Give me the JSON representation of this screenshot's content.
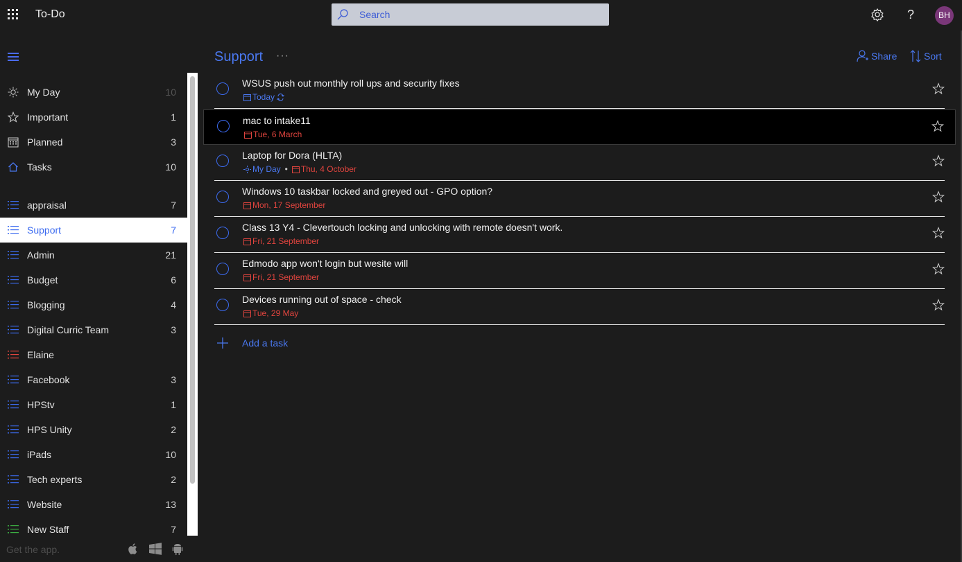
{
  "app": {
    "title": "To-Do"
  },
  "search": {
    "placeholder": "Search"
  },
  "user": {
    "initials": "BH"
  },
  "header_icons": [
    "waffle-icon",
    "gear-icon",
    "help-icon"
  ],
  "sidebar": {
    "smart_lists": [
      {
        "label": "My Day",
        "count": "10",
        "icon": "sun-icon"
      },
      {
        "label": "Important",
        "count": "1",
        "icon": "star-icon"
      },
      {
        "label": "Planned",
        "count": "3",
        "icon": "calendar-icon"
      },
      {
        "label": "Tasks",
        "count": "10",
        "icon": "home-icon"
      }
    ],
    "lists": [
      {
        "label": "appraisal",
        "count": "7",
        "color": "#3c6bf0"
      },
      {
        "label": "Support",
        "count": "7",
        "color": "#3c6bf0",
        "active": true
      },
      {
        "label": "Admin",
        "count": "21",
        "color": "#3c6bf0"
      },
      {
        "label": "Budget",
        "count": "6",
        "color": "#3c6bf0"
      },
      {
        "label": "Blogging",
        "count": "4",
        "color": "#3c6bf0"
      },
      {
        "label": "Digital Curric Team",
        "count": "3",
        "color": "#3c6bf0"
      },
      {
        "label": "Elaine",
        "count": "",
        "color": "#e0443e"
      },
      {
        "label": "Facebook",
        "count": "3",
        "color": "#3c6bf0"
      },
      {
        "label": "HPStv",
        "count": "1",
        "color": "#3c6bf0"
      },
      {
        "label": "HPS Unity",
        "count": "2",
        "color": "#3c6bf0"
      },
      {
        "label": "iPads",
        "count": "10",
        "color": "#3c6bf0"
      },
      {
        "label": "Tech experts",
        "count": "2",
        "color": "#3c6bf0"
      },
      {
        "label": "Website",
        "count": "13",
        "color": "#3c6bf0"
      },
      {
        "label": "New Staff",
        "count": "7",
        "color": "#3cb043"
      }
    ],
    "get_app": "Get the app.",
    "platforms": [
      "apple-icon",
      "windows-icon",
      "android-icon"
    ]
  },
  "main": {
    "title": "Support",
    "more": "···",
    "share_label": "Share",
    "sort_label": "Sort",
    "add_task_label": "Add a task",
    "tasks": [
      {
        "title": "WSUS push out monthly roll ups and security fixes",
        "meta": [
          {
            "text": "Today",
            "color": "blue",
            "icon": "calendar-icon",
            "repeat": true
          }
        ]
      },
      {
        "title": "mac to intake11",
        "selected": true,
        "meta": [
          {
            "text": "Tue, 6 March",
            "color": "red",
            "icon": "calendar-icon"
          }
        ]
      },
      {
        "title": "Laptop for Dora (HLTA)",
        "meta": [
          {
            "text": "My Day",
            "color": "blue",
            "icon": "sun-icon"
          },
          {
            "text": "Thu, 4 October",
            "color": "red",
            "icon": "calendar-icon"
          }
        ]
      },
      {
        "title": "Windows 10 taskbar locked and greyed out - GPO option?",
        "meta": [
          {
            "text": "Mon, 17 September",
            "color": "red",
            "icon": "calendar-icon"
          }
        ]
      },
      {
        "title": "Class 13 Y4 - Clevertouch locking and unlocking with remote doesn't work.",
        "meta": [
          {
            "text": "Fri, 21 September",
            "color": "red",
            "icon": "calendar-icon"
          }
        ]
      },
      {
        "title": "Edmodo app won't login but wesite will",
        "meta": [
          {
            "text": "Fri, 21 September",
            "color": "red",
            "icon": "calendar-icon"
          }
        ]
      },
      {
        "title": "Devices running out of space - check",
        "meta": [
          {
            "text": "Tue, 29 May",
            "color": "red",
            "icon": "calendar-icon"
          }
        ]
      }
    ]
  }
}
